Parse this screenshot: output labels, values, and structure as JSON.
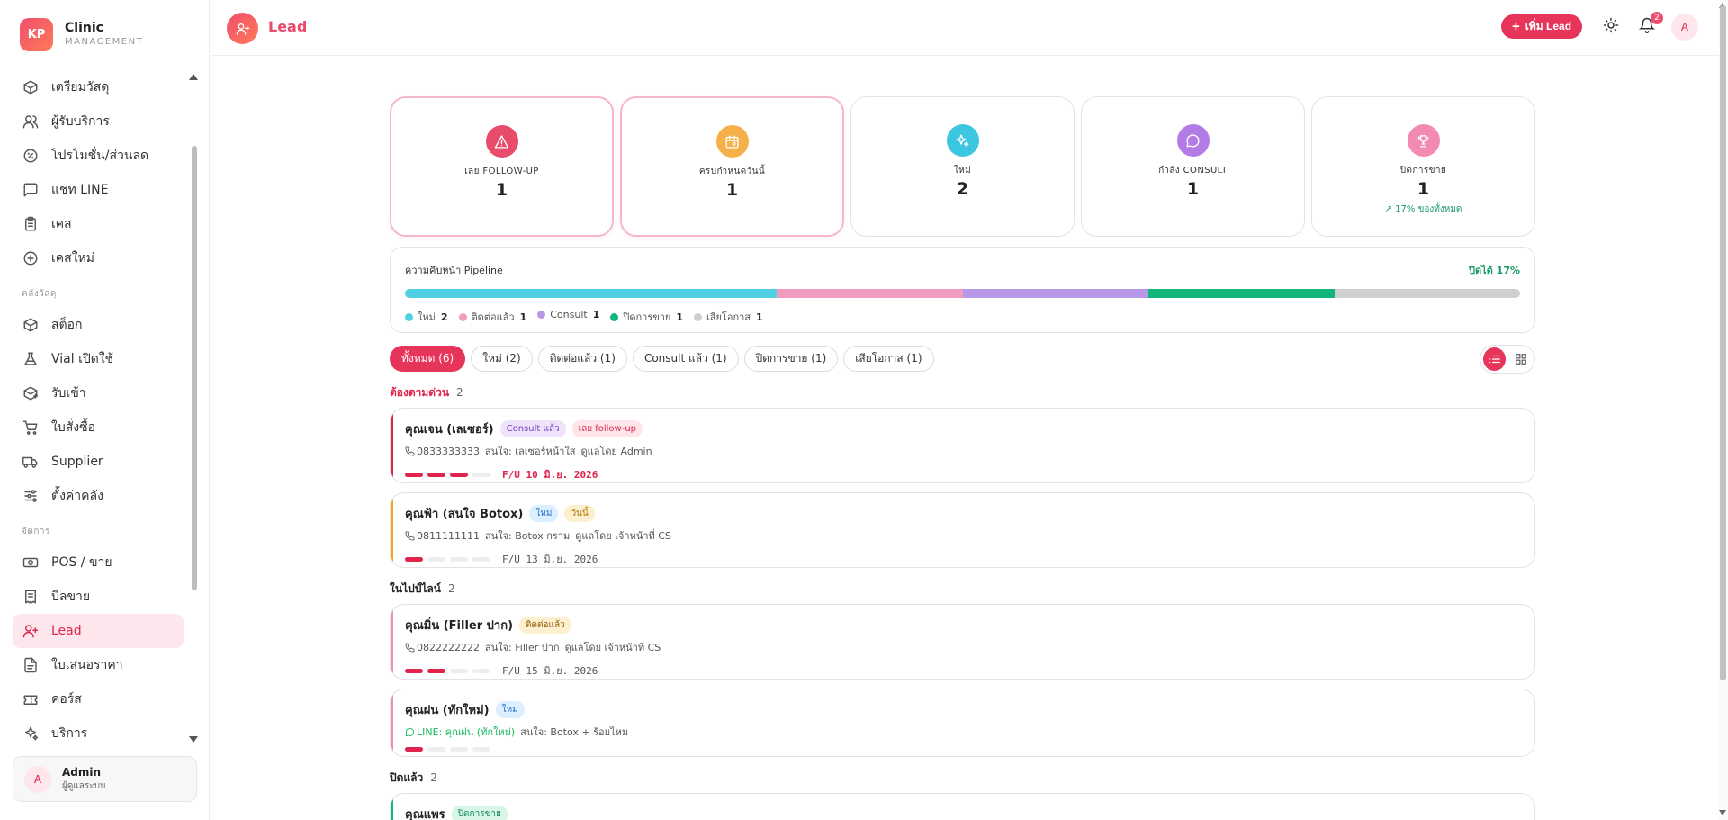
{
  "brand": {
    "initials": "KP",
    "title": "Clinic",
    "subtitle": "MANAGEMENT"
  },
  "sidebar": {
    "top_items": [
      {
        "label": "เตรียมวัสดุ",
        "icon": "package-icon"
      },
      {
        "label": "ผู้รับบริการ",
        "icon": "users-icon"
      },
      {
        "label": "โปรโมชั่น/ส่วนลด",
        "icon": "discount-icon"
      },
      {
        "label": "แชท LINE",
        "icon": "chat-icon"
      },
      {
        "label": "เคส",
        "icon": "clipboard-icon"
      },
      {
        "label": "เคสใหม่",
        "icon": "plus-circle-icon"
      }
    ],
    "section_inventory": "คลังวัสดุ",
    "inventory_items": [
      {
        "label": "สต็อก",
        "icon": "box-icon"
      },
      {
        "label": "Vial เปิดใช้",
        "icon": "flask-icon"
      },
      {
        "label": "รับเข้า",
        "icon": "package-in-icon"
      },
      {
        "label": "ใบสั่งซื้อ",
        "icon": "cart-icon"
      },
      {
        "label": "Supplier",
        "icon": "truck-icon"
      },
      {
        "label": "ตั้งค่าคลัง",
        "icon": "sliders-icon"
      }
    ],
    "section_manage": "จัดการ",
    "manage_items": [
      {
        "label": "POS / ขาย",
        "icon": "cash-icon"
      },
      {
        "label": "บิลขาย",
        "icon": "receipt-icon"
      },
      {
        "label": "Lead",
        "icon": "user-plus-icon"
      },
      {
        "label": "ใบเสนอราคา",
        "icon": "file-icon"
      },
      {
        "label": "คอร์ส",
        "icon": "ticket-icon"
      },
      {
        "label": "บริการ",
        "icon": "sparkles-icon"
      }
    ]
  },
  "user": {
    "initial": "A",
    "name": "Admin",
    "role": "ผู้ดูแลระบบ"
  },
  "header": {
    "title": "Lead",
    "add_label": "เพิ่ม Lead",
    "notif_count": "2",
    "avatar": "A"
  },
  "stats": [
    {
      "label": "เลย FOLLOW-UP",
      "value": "1",
      "color": "#e94b6a",
      "icon": "alert-icon",
      "highlight": true,
      "note": ""
    },
    {
      "label": "ครบกำหนดวันนี้",
      "value": "1",
      "color": "#f6b04a",
      "icon": "calendar-icon",
      "highlight": true,
      "note": ""
    },
    {
      "label": "ใหม่",
      "value": "2",
      "color": "#3cc6e0",
      "icon": "sparkle-icon",
      "highlight": false,
      "note": ""
    },
    {
      "label": "กำลัง CONSULT",
      "value": "1",
      "color": "#b37be6",
      "icon": "message-icon",
      "highlight": false,
      "note": ""
    },
    {
      "label": "ปิดการขาย",
      "value": "1",
      "color": "#f28ab4",
      "icon": "trophy-icon",
      "highlight": false,
      "note": "↗ 17% ของทั้งหมด"
    }
  ],
  "pipeline": {
    "title": "ความคืบหน้า Pipeline",
    "close_label": "ปิดได้ 17%",
    "stages": [
      {
        "name": "ใหม่",
        "count": "2",
        "value": 2,
        "color": "#4fd0e3"
      },
      {
        "name": "ติดต่อแล้ว",
        "count": "1",
        "value": 1,
        "color": "#f29bc1"
      },
      {
        "name": "Consult",
        "count": "1",
        "value": 1,
        "color": "#b897e8"
      },
      {
        "name": "ปิดการขาย",
        "count": "1",
        "value": 1,
        "color": "#10b67a"
      },
      {
        "name": "เสียโอกาส",
        "count": "1",
        "value": 1,
        "color": "#cfcfcf"
      }
    ]
  },
  "filters": [
    "ทั้งหมด (6)",
    "ใหม่ (2)",
    "ติดต่อแล้ว (1)",
    "Consult แล้ว (1)",
    "ปิดการขาย (1)",
    "เสียโอกาส (1)"
  ],
  "groups": [
    {
      "title": "ต้องตามด่วน",
      "count": "2",
      "urgent": true,
      "leads": [
        {
          "name": "คุณเจน (เลเซอร์)",
          "stripe": "#e0244c",
          "tags": [
            {
              "text": "Consult แล้ว",
              "bg": "#efe2fb",
              "fg": "#7b3fc4"
            },
            {
              "text": "เลย follow-up",
              "bg": "#fde5ea",
              "fg": "#e0244c"
            }
          ],
          "contact": "0833333333",
          "contact_type": "phone",
          "interest": "สนใจ: เลเซอร์หน้าใส",
          "owner": "ดูแลโดย Admin",
          "progress": 3,
          "fu": "F/U 10 มิ.ย. 2026",
          "fu_red": true
        },
        {
          "name": "คุณฟ้า (สนใจ Botox)",
          "stripe": "#f6a21e",
          "tags": [
            {
              "text": "ใหม่",
              "bg": "#dcefff",
              "fg": "#2a6fcf"
            },
            {
              "text": "วันนี้",
              "bg": "#fdf0cf",
              "fg": "#b37400"
            }
          ],
          "contact": "0811111111",
          "contact_type": "phone",
          "interest": "สนใจ: Botox กราม",
          "owner": "ดูแลโดย เจ้าหน้าที่ CS",
          "progress": 1,
          "fu": "F/U 13 มิ.ย. 2026",
          "fu_red": false
        }
      ]
    },
    {
      "title": "ในไปป์ไลน์",
      "count": "2",
      "urgent": false,
      "leads": [
        {
          "name": "คุณมิ่น (Filler ปาก)",
          "stripe": "#f08fae",
          "tags": [
            {
              "text": "ติดต่อแล้ว",
              "bg": "#fdf0cf",
              "fg": "#8a5a00"
            }
          ],
          "contact": "0822222222",
          "contact_type": "phone",
          "interest": "สนใจ: Filler ปาก",
          "owner": "ดูแลโดย เจ้าหน้าที่ CS",
          "progress": 2,
          "fu": "F/U 15 มิ.ย. 2026",
          "fu_red": false
        },
        {
          "name": "คุณฝน (ทักใหม่)",
          "stripe": "#f08fae",
          "tags": [
            {
              "text": "ใหม่",
              "bg": "#dcefff",
              "fg": "#2a6fcf"
            }
          ],
          "contact": "LINE: คุณฝน (ทักใหม่)",
          "contact_type": "line",
          "interest": "สนใจ: Botox + ร้อยไหม",
          "owner": "",
          "progress": 1,
          "fu": "",
          "fu_red": false
        }
      ]
    },
    {
      "title": "ปิดแล้ว",
      "count": "2",
      "urgent": false,
      "leads": [
        {
          "name": "คุณแพร",
          "stripe": "#10b67a",
          "tags": [
            {
              "text": "ปิดการขาย",
              "bg": "#d9f5e8",
              "fg": "#0f8a5a"
            }
          ],
          "contact": "",
          "contact_type": "phone",
          "interest": "",
          "owner": "",
          "progress": 0,
          "fu": "",
          "fu_red": false
        }
      ]
    }
  ]
}
